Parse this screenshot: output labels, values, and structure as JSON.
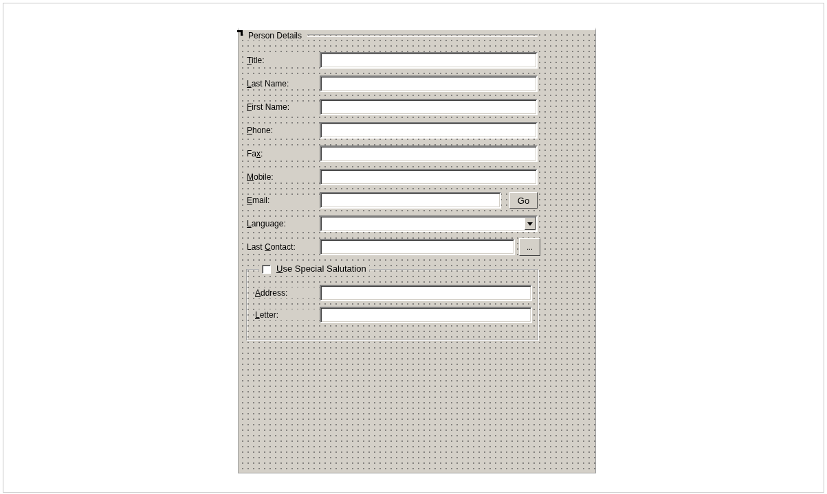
{
  "group": {
    "title": "Person Details"
  },
  "fields": [
    {
      "kind": "text",
      "label": {
        "key": "T",
        "after": "itle:"
      }
    },
    {
      "kind": "text",
      "label": {
        "key": "L",
        "after": "ast Name:"
      }
    },
    {
      "kind": "text",
      "label": {
        "key": "F",
        "after": "irst Name:"
      }
    },
    {
      "kind": "text",
      "label": {
        "key": "P",
        "after": "hone:"
      }
    },
    {
      "kind": "text",
      "label": {
        "before": "Fa",
        "key": "x",
        "after": ":"
      }
    },
    {
      "kind": "text",
      "label": {
        "key": "M",
        "after": "obile:"
      }
    },
    {
      "kind": "button",
      "label": {
        "key": "E",
        "after": "mail:"
      },
      "button": "Go"
    },
    {
      "kind": "combo",
      "label": {
        "key": "L",
        "after": "anguage:"
      }
    },
    {
      "kind": "picker",
      "label": {
        "before": "Last ",
        "key": "C",
        "after": "ontact:"
      },
      "button": "..."
    }
  ],
  "salutation": {
    "label": {
      "key": "U",
      "after": "se Special Salutation"
    },
    "checked": false,
    "fields": [
      {
        "kind": "text",
        "label": {
          "key": "A",
          "after": "ddress:"
        }
      },
      {
        "kind": "text",
        "label": {
          "key": "L",
          "after": "etter:"
        }
      }
    ]
  }
}
